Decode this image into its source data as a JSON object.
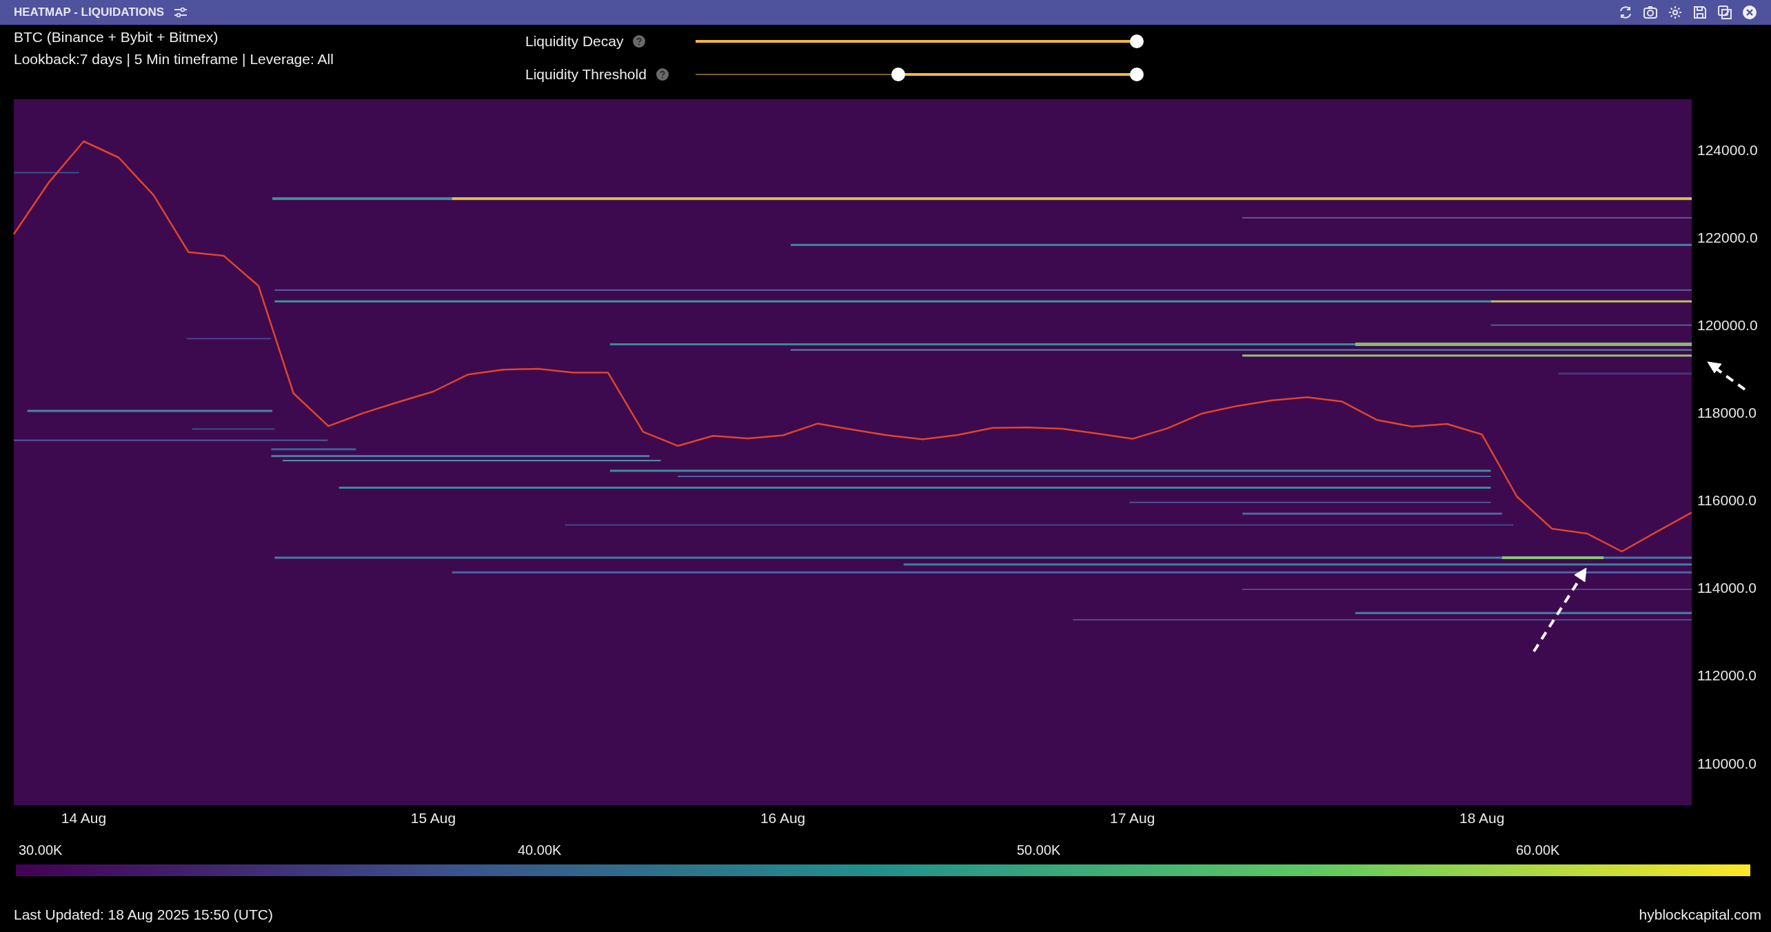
{
  "window": {
    "title": "HEATMAP - LIQUIDATIONS"
  },
  "info": {
    "line_1": "BTC (Binance + Bybit + Bitmex)",
    "line_2": "Lookback:7 days | 5 Min timeframe | Leverage: All"
  },
  "sliders": [
    {
      "label": "Liquidity Decay",
      "thumbs": [
        {
          "level": 1
        }
      ]
    },
    {
      "label": "Liquidity Threshold",
      "thumbs": [
        {
          "level": 0.46
        },
        {
          "level": 1
        }
      ]
    }
  ],
  "chart": {
    "chart_data": {
      "type": "line",
      "categories": [
        null,
        null,
        "14 Aug",
        null,
        null,
        null,
        null,
        null,
        null,
        null,
        null,
        null,
        "15 Aug",
        null,
        null,
        null,
        null,
        null,
        null,
        null,
        null,
        null,
        "16 Aug",
        null,
        null,
        null,
        null,
        null,
        null,
        null,
        null,
        null,
        "17 Aug",
        null,
        null,
        null,
        null,
        null,
        null,
        null,
        null,
        null,
        "18 Aug",
        null,
        null,
        null,
        null,
        null,
        null
      ],
      "series": [
        {
          "color": "#e0452b",
          "values": [
            122080,
            123260,
            124200,
            123830,
            122970,
            121670,
            121590,
            120900,
            118450,
            117700,
            118000,
            118250,
            118490,
            118880,
            118990,
            119010,
            118920,
            118920,
            117570,
            117250,
            117480,
            117420,
            117490,
            117760,
            117620,
            117490,
            117400,
            117500,
            117660,
            117670,
            117640,
            117530,
            117410,
            117650,
            117990,
            118160,
            118290,
            118360,
            118260,
            117840,
            117690,
            117750,
            117510,
            116090,
            115360,
            115250,
            114840,
            115290,
            115730
          ]
        }
      ],
      "ylim": [
        109050,
        125160
      ],
      "yticks": [
        {
          "value": 110000,
          "label": "110000.0"
        },
        {
          "value": 112000,
          "label": "112000.0"
        },
        {
          "value": 114000,
          "label": "114000.0"
        },
        {
          "value": 116000,
          "label": "116000.0"
        },
        {
          "value": 118000,
          "label": "118000.0"
        },
        {
          "value": 120000,
          "label": "120000.0"
        },
        {
          "value": 122000,
          "label": "122000.0"
        },
        {
          "value": 124000,
          "label": "124000.0"
        }
      ]
    }
  },
  "colorbar": {
    "labels": [
      "30.00K",
      "40.00K",
      "50.00K",
      "60.00K"
    ]
  },
  "footer": {
    "last_updated": "Last Updated: 18 Aug 2025 15:50 (UTC)",
    "site": "hyblockcapital.com"
  }
}
